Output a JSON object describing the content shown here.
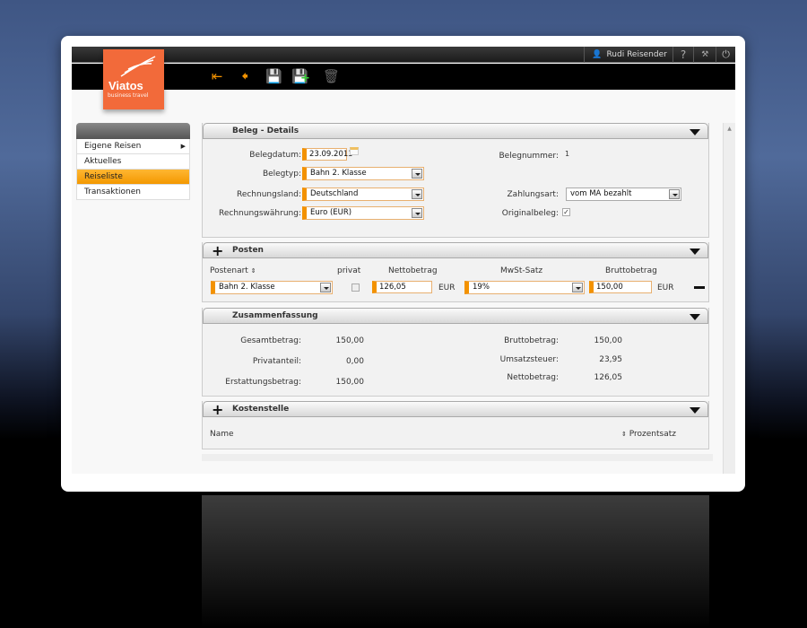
{
  "header": {
    "user": "Rudi Reisender",
    "help": "?",
    "logo_name": "Viatos",
    "logo_sub": "business travel"
  },
  "toolbar": [
    "first-icon",
    "back-icon",
    "save-icon",
    "save-new-icon",
    "delete-icon"
  ],
  "sidebar": {
    "items": [
      {
        "label": "Eigene Reisen"
      },
      {
        "label": "Aktuelles"
      },
      {
        "label": "Reiseliste"
      },
      {
        "label": "Transaktionen"
      }
    ]
  },
  "details": {
    "title": "Beleg - Details",
    "belegdatum_label": "Belegdatum:",
    "belegdatum": "23.09.2013",
    "belegtyp_label": "Belegtyp:",
    "belegtyp": "Bahn 2. Klasse",
    "land_label": "Rechnungsland:",
    "land": "Deutschland",
    "waehrung_label": "Rechnungswährung:",
    "waehrung": "Euro (EUR)",
    "belegnummer_label": "Belegnummer:",
    "belegnummer": "1",
    "zahlungsart_label": "Zahlungsart:",
    "zahlungsart": "vom MA bezahlt",
    "original_label": "Originalbeleg:"
  },
  "posten": {
    "title": "Posten",
    "col_postenart": "Postenart",
    "col_privat": "privat",
    "col_netto": "Nettobetrag",
    "col_mwst": "MwSt-Satz",
    "col_brutto": "Bruttobetrag",
    "postenart": "Bahn 2. Klasse",
    "netto": "126,05",
    "netto_cur": "EUR",
    "mwst": "19%",
    "brutto": "150,00",
    "brutto_cur": "EUR"
  },
  "summary": {
    "title": "Zusammenfassung",
    "gesamt_label": "Gesamtbetrag:",
    "gesamt": "150,00",
    "privat_label": "Privatanteil:",
    "privat": "0,00",
    "erstattung_label": "Erstattungsbetrag:",
    "erstattung": "150,00",
    "brutto_label": "Bruttobetrag:",
    "brutto": "150,00",
    "ust_label": "Umsatzsteuer:",
    "ust": "23,95",
    "netto_label": "Nettobetrag:",
    "netto": "126,05"
  },
  "kostenstelle": {
    "title": "Kostenstelle",
    "col_name": "Name",
    "col_prozent": "Prozentsatz"
  }
}
